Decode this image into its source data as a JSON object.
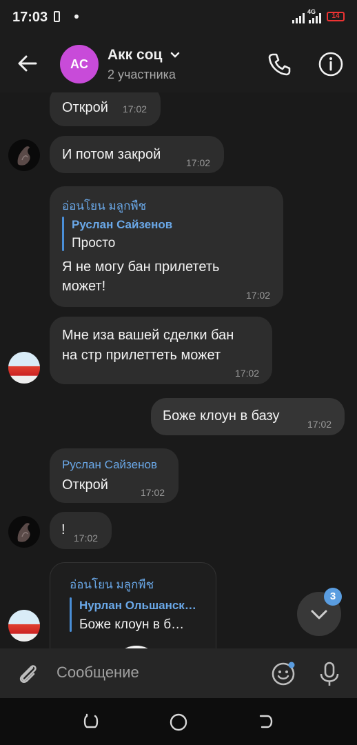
{
  "status_bar": {
    "time": "17:03",
    "network": "4G",
    "battery": "14"
  },
  "header": {
    "avatar_initials": "AC",
    "title": "Акк соц",
    "subtitle": "2 участника"
  },
  "messages": [
    {
      "text": "Открой",
      "time": "17:02"
    },
    {
      "text": "И потом закрой",
      "time": "17:02"
    },
    {
      "sender": "อ่อนโยน มลูกพืช",
      "quote_name": "Руслан Сайзенов",
      "quote_text": "Просто",
      "text_line1": "Я не могу бан прилететь",
      "text_line2": "может!",
      "time": "17:02"
    },
    {
      "text_line1": "Мне иза вашей сделки бан",
      "text_line2": "на стр прилеттеть может",
      "time": "17:02"
    },
    {
      "text": "Боже клоун в базу",
      "time": "17:02"
    },
    {
      "sender": "Руслан Сайзенов",
      "text": "Открой",
      "time": "17:02"
    },
    {
      "text": "!",
      "time": "17:02"
    },
    {
      "sender": "อ่อนโยน มลูกพืช",
      "quote_name": "Нурлан Ольшанск…",
      "quote_text": "Боже клоун в б…"
    }
  ],
  "scroll_badge": "3",
  "input": {
    "placeholder": "Сообщение"
  },
  "colors": {
    "accent": "#6aa8e8",
    "avatar": "#c84bd9",
    "background": "#1a1a1a",
    "bubble": "#2d2d2d"
  }
}
